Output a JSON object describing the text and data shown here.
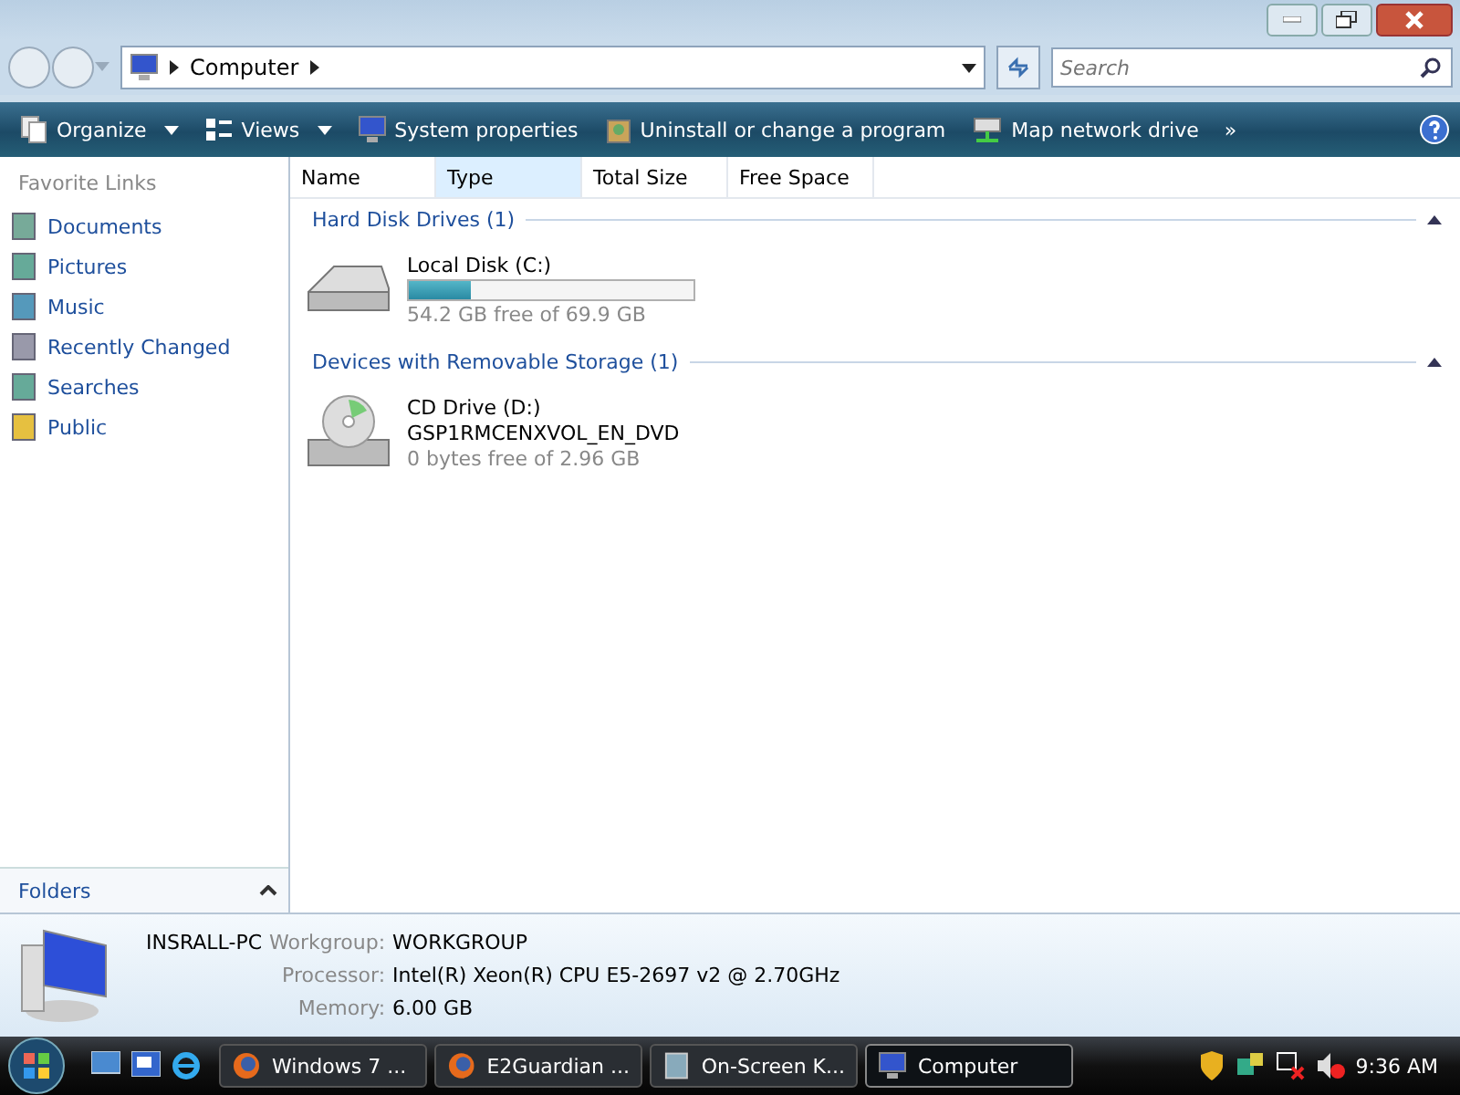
{
  "address": {
    "path": "Computer",
    "search_placeholder": "Search"
  },
  "toolbar": {
    "items": [
      {
        "label": "Organize",
        "dropdown": true
      },
      {
        "label": "Views",
        "dropdown": true
      },
      {
        "label": "System properties",
        "dropdown": false
      },
      {
        "label": "Uninstall or change a program",
        "dropdown": false
      },
      {
        "label": "Map network drive",
        "dropdown": false
      }
    ],
    "more": "»"
  },
  "sidebar": {
    "heading": "Favorite Links",
    "items": [
      {
        "label": "Documents"
      },
      {
        "label": "Pictures"
      },
      {
        "label": "Music"
      },
      {
        "label": "Recently Changed"
      },
      {
        "label": "Searches"
      },
      {
        "label": "Public"
      }
    ],
    "folders": "Folders"
  },
  "columns": [
    {
      "label": "Name",
      "selected": false
    },
    {
      "label": "Type",
      "selected": true
    },
    {
      "label": "Total Size",
      "selected": false
    },
    {
      "label": "Free Space",
      "selected": false
    }
  ],
  "groups": [
    {
      "title": "Hard Disk Drives (1)",
      "items": [
        {
          "kind": "disk",
          "name": "Local Disk (C:)",
          "level": 0.22,
          "free": "54.2 GB free of 69.9 GB"
        }
      ]
    },
    {
      "title": "Devices with Removable Storage (1)",
      "items": [
        {
          "kind": "cd",
          "name": "CD Drive (D:)",
          "volume": "GSP1RMCENXVOL_EN_DVD",
          "free": "0 bytes free of 2.96 GB"
        }
      ]
    }
  ],
  "details": {
    "computer": "INSRALL-PC",
    "fields": [
      {
        "label": "Workgroup:",
        "value": "WORKGROUP"
      },
      {
        "label": "Processor:",
        "value": "Intel(R) Xeon(R) CPU E5-2697 v2 @ 2.70GHz"
      },
      {
        "label": "Memory:",
        "value": "6.00 GB"
      }
    ]
  },
  "taskbar": {
    "tasks": [
      {
        "label": "Windows 7 ...",
        "selected": false
      },
      {
        "label": "E2Guardian ...",
        "selected": false
      },
      {
        "label": "On-Screen K...",
        "selected": false
      },
      {
        "label": "Computer",
        "selected": true
      }
    ],
    "clock": "9:36 AM"
  }
}
